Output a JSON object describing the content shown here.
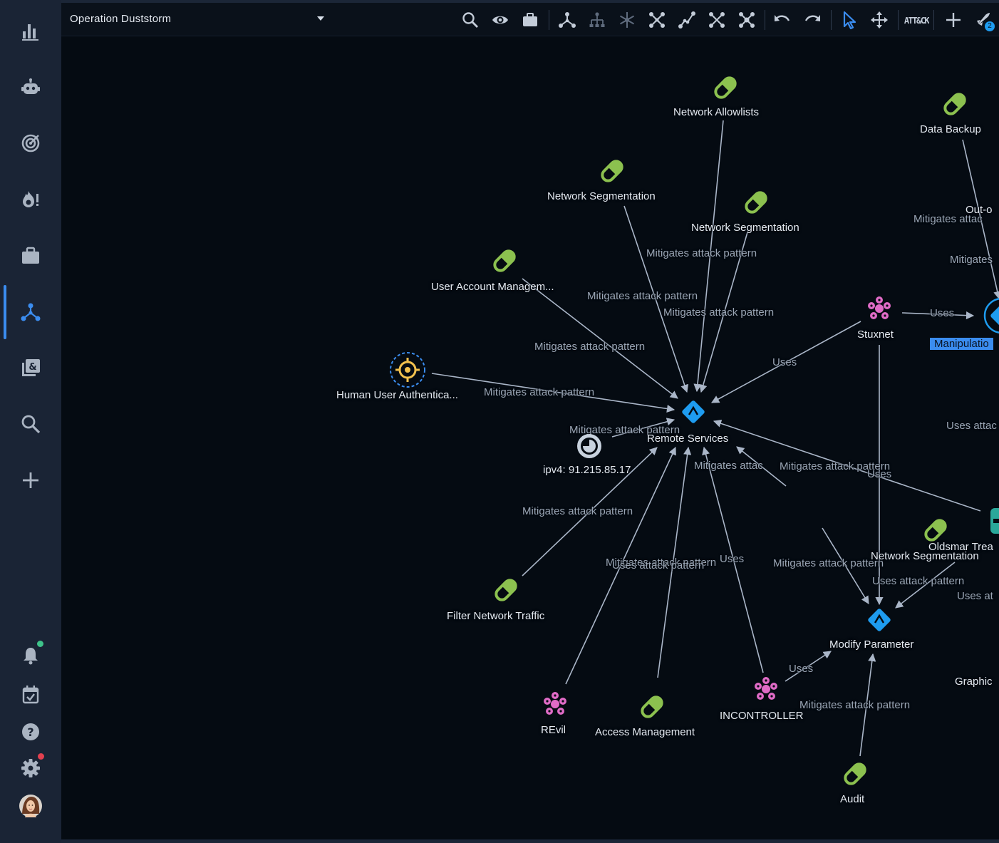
{
  "window": {
    "title": "Operation Duststorm"
  },
  "colors": {
    "accent": "#3b8df0",
    "mitigation": "#8cc14f",
    "malware": "#e06bc6",
    "attack_pattern": "#1e9cf0",
    "location": "#f2c14e",
    "observable": "#c8d2de",
    "notification_dot": "#3ec38a",
    "settings_dot": "#e2404f"
  },
  "sidebar": {
    "items": [
      {
        "name": "dashboard",
        "icon": "bar-chart-icon"
      },
      {
        "name": "automation",
        "icon": "robot-icon"
      },
      {
        "name": "analyses",
        "icon": "target-icon"
      },
      {
        "name": "events",
        "icon": "fire-alert-icon"
      },
      {
        "name": "cases",
        "icon": "briefcase-icon"
      },
      {
        "name": "graph",
        "icon": "graph-nodes-icon"
      },
      {
        "name": "knowledge",
        "icon": "library-icon"
      },
      {
        "name": "search",
        "icon": "search-icon"
      },
      {
        "name": "create",
        "icon": "plus-icon"
      },
      {
        "name": "notifications",
        "icon": "bell-icon"
      },
      {
        "name": "calendar",
        "icon": "calendar-check-icon"
      },
      {
        "name": "help",
        "icon": "help-icon"
      },
      {
        "name": "settings",
        "icon": "gear-icon"
      },
      {
        "name": "profile",
        "icon": "avatar"
      }
    ]
  },
  "toolbar": {
    "tools": [
      "search-icon",
      "eye-icon",
      "briefcase-icon",
      "graph-nodes-icon",
      "tree-icon",
      "snowflake-icon",
      "scatter-nodes-icon",
      "path-icon",
      "expand-nodes-icon",
      "collapse-nodes-icon",
      "undo-icon",
      "redo-icon",
      "pointer-icon",
      "move-icon",
      "attack-matrix-icon",
      "plus-icon",
      "rocket-icon"
    ],
    "attack_label": "ATT&CK",
    "rocket_badge": "2"
  },
  "graph": {
    "nodes": [
      {
        "id": "n1",
        "type": "mitigation",
        "label": "Network Allowlists"
      },
      {
        "id": "n2",
        "type": "mitigation",
        "label": "Data Backup"
      },
      {
        "id": "n3",
        "type": "mitigation",
        "label": "Network Segmentation"
      },
      {
        "id": "n4",
        "type": "mitigation",
        "label": "Network Segmentation"
      },
      {
        "id": "n5",
        "type": "mitigation",
        "label": "User Account Managem..."
      },
      {
        "id": "n6",
        "type": "malware",
        "label": "Stuxnet"
      },
      {
        "id": "n7",
        "type": "attack-pattern",
        "label": "Manipulatio",
        "selected": true
      },
      {
        "id": "n8",
        "type": "location",
        "label": "Human User Authentica..."
      },
      {
        "id": "n9",
        "type": "attack-pattern",
        "label": "Remote Services"
      },
      {
        "id": "n10",
        "type": "observable",
        "label": "ipv4: 91.215.85.17"
      },
      {
        "id": "n11",
        "type": "mitigation",
        "label": "Network Segmentation"
      },
      {
        "id": "n12",
        "type": "incident",
        "label": "Oldsmar Trea"
      },
      {
        "id": "n13",
        "type": "mitigation",
        "label": "Filter Network Traffic"
      },
      {
        "id": "n14",
        "type": "attack-pattern",
        "label": "Modify Parameter"
      },
      {
        "id": "n15",
        "type": "malware",
        "label": "REvil"
      },
      {
        "id": "n16",
        "type": "mitigation",
        "label": "Access Management"
      },
      {
        "id": "n17",
        "type": "malware",
        "label": "INCONTROLLER"
      },
      {
        "id": "n18",
        "type": "mitigation",
        "label": "Audit"
      },
      {
        "id": "n19",
        "type": "other",
        "label": "Graphic"
      },
      {
        "id": "n20",
        "type": "other",
        "label": "Out-o"
      }
    ],
    "edge_labels": [
      "Mitigates attack pattern",
      "Mitigates attack pattern",
      "Mitigates attack pattern",
      "Mitigates attack pattern",
      "Mitigates attack pattern",
      "Mitigates attack pattern",
      "Uses",
      "Uses",
      "Mitigates attac",
      "Mitigates",
      "Mitigates attack pattern",
      "Mitigates attac",
      "Mitigates attack pattern",
      "Uses",
      "Uses attac",
      "Mitigates attack pattern",
      "Mitigates attack pattern",
      "Uses",
      "Mitigates attack pattern",
      "Uses",
      "Mitigates attack pattern",
      "Uses attack pattern",
      "Uses at",
      "Uses",
      "Mitigates attack pattern"
    ]
  }
}
